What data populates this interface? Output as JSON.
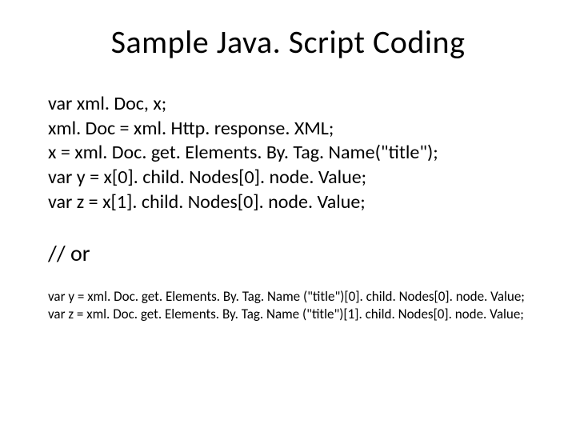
{
  "title": "Sample Java. Script Coding",
  "code1": {
    "line1": "var xml. Doc, x;",
    "line2": "xml. Doc = xml. Http. response. XML;",
    "line3": "x = xml. Doc. get. Elements. By. Tag. Name(\"title\");",
    "line4": "var y = x[0]. child. Nodes[0]. node. Value;",
    "line5": "var z = x[1]. child. Nodes[0]. node. Value;"
  },
  "or_label": "// or",
  "code2": {
    "line1": "var y = xml. Doc. get. Elements. By. Tag. Name (\"title\")[0]. child. Nodes[0]. node. Value;",
    "line2": "var z = xml. Doc. get. Elements. By. Tag. Name (\"title\")[1]. child. Nodes[0]. node. Value;"
  }
}
